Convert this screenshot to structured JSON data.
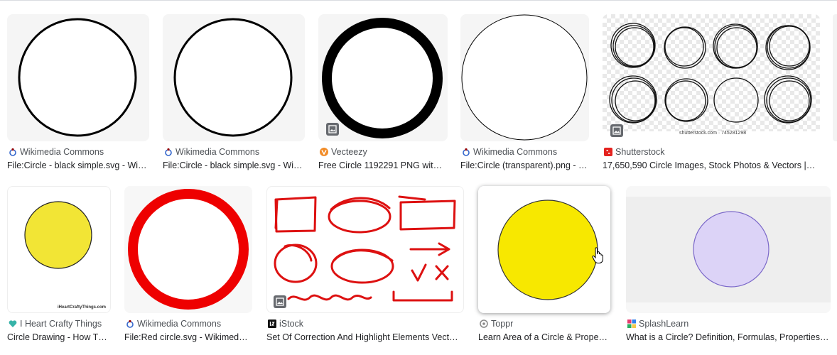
{
  "results": [
    {
      "source": "Wikimedia Commons",
      "caption": "File:Circle - black simple.svg - Wi…"
    },
    {
      "source": "Wikimedia Commons",
      "caption": "File:Circle - black simple.svg - Wi…"
    },
    {
      "source": "Vecteezy",
      "caption": "Free Circle 1192291 PNG wit…"
    },
    {
      "source": "Wikimedia Commons",
      "caption": "File:Circle (transparent).png - …"
    },
    {
      "source": "Shutterstock",
      "caption": "17,650,590 Circle Images, Stock Photos & Vectors | …",
      "watermark": "shutterstock.com · 745281298"
    },
    {
      "source": "I Heart Crafty Things",
      "caption": "Circle Drawing - How T…",
      "watermark": "iHeartCraftyThings.com"
    },
    {
      "source": "Wikimedia Commons",
      "caption": "File:Red circle.svg - Wikimedi…"
    },
    {
      "source": "iStock",
      "caption": "Set Of Correction And Highlight Elements Vecto…"
    },
    {
      "source": "Toppr",
      "caption": "Learn Area of a Circle & Proper…"
    },
    {
      "source": "SplashLearn",
      "caption": "What is a Circle? Definition, Formulas, Properties,…"
    }
  ],
  "colors": {
    "yellow_craft": "#f2e535",
    "red_circle": "#ee0000",
    "yellow_toppr": "#f7e800",
    "lavender": "#dcd3f7",
    "lavender_stroke": "#7b68c9",
    "wiki_blue": "#3366cc",
    "vecteezy_orange": "#f28c28",
    "shutterstock_red": "#e4231f",
    "crafty_teal": "#36b3a8"
  },
  "icons": [
    "wikimedia-icon",
    "vecteezy-icon",
    "shutterstock-icon",
    "heart-icon",
    "istock-icon",
    "toppr-icon",
    "splashlearn-icon",
    "image-badge-icon",
    "hand-cursor-icon"
  ]
}
